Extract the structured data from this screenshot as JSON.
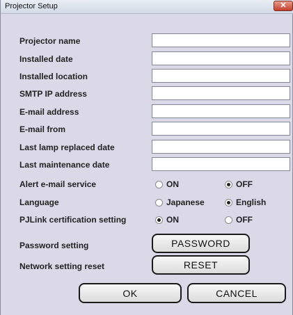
{
  "window": {
    "title": "Projector Setup",
    "close_glyph": "✕"
  },
  "fields": [
    {
      "label": "Projector name",
      "value": ""
    },
    {
      "label": "Installed date",
      "value": ""
    },
    {
      "label": "Installed location",
      "value": ""
    },
    {
      "label": "SMTP IP address",
      "value": ""
    },
    {
      "label": "E-mail address",
      "value": ""
    },
    {
      "label": "E-mail from",
      "value": ""
    },
    {
      "label": "Last lamp replaced date",
      "value": ""
    },
    {
      "label": "Last maintenance date",
      "value": ""
    }
  ],
  "radio_groups": [
    {
      "label": "Alert e-mail service",
      "options": [
        "ON",
        "OFF"
      ],
      "selected": "OFF"
    },
    {
      "label": "Language",
      "options": [
        "Japanese",
        "English"
      ],
      "selected": "English"
    },
    {
      "label": "PJLink certification setting",
      "options": [
        "ON",
        "OFF"
      ],
      "selected": "ON"
    }
  ],
  "password": {
    "label": "Password setting",
    "button": "PASSWORD"
  },
  "reset": {
    "label": "Network setting reset",
    "button": "RESET"
  },
  "footer": {
    "ok": "OK",
    "cancel": "CANCEL"
  },
  "icons": {
    "close": "close-icon",
    "radio": "radio-icon"
  }
}
